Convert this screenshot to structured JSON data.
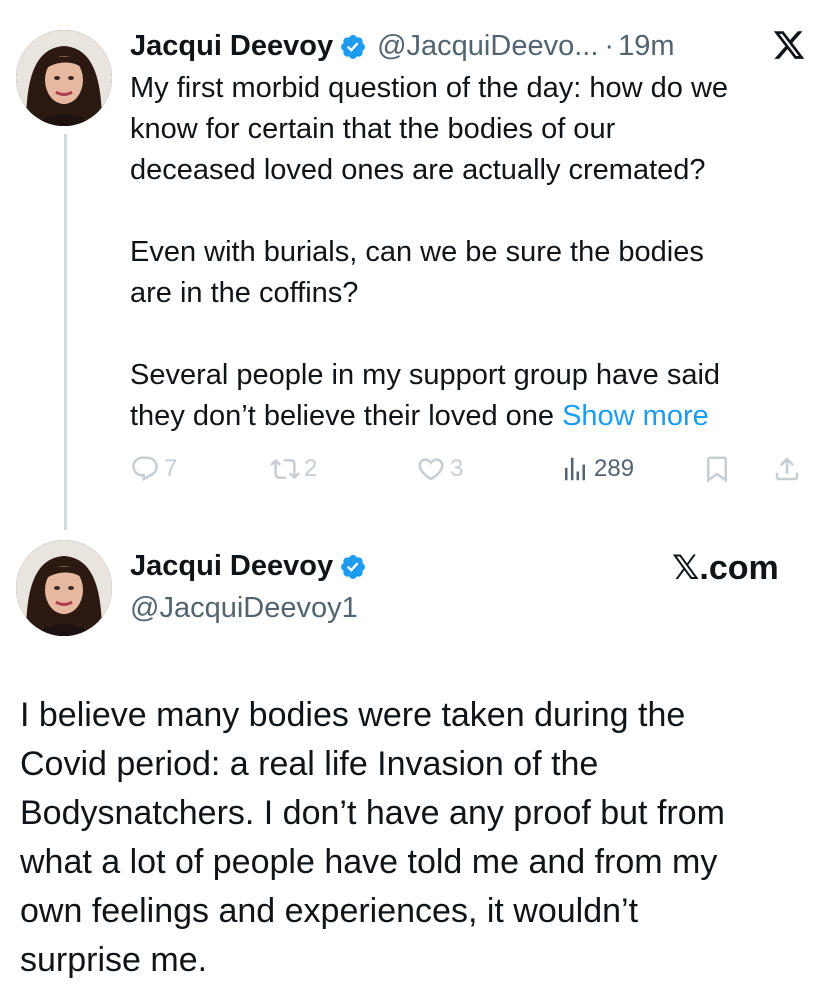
{
  "tweet": {
    "author_name": "Jacqui Deevoy",
    "handle_truncated": "@JacquiDeevo...",
    "separator": "·",
    "time": "19m",
    "text_lines": [
      "My first morbid question of the day: how do we",
      "know for certain that the bodies of our",
      "deceased loved ones are actually cremated?",
      "",
      "Even with burials, can we be sure the bodies",
      "are in the coffins?",
      "",
      "Several people in my support group have said",
      "they don’t believe their loved one "
    ],
    "show_more": "Show more",
    "actions": {
      "replies": "7",
      "reposts": "2",
      "likes": "3",
      "views": "289"
    }
  },
  "card": {
    "author_name": "Jacqui Deevoy",
    "handle": "@JacquiDeevoy1",
    "brand": "𝕏.com",
    "text": "I believe many bodies were taken during the\nCovid period: a real life Invasion of the\nBodysnatchers. I don’t have any proof but from\nwhat a lot of people have told me and from my\nown feelings and experiences, it wouldn’t\nsurprise me."
  },
  "icons": {
    "verified": "verified-badge-icon",
    "x_logo": "x-logo-icon",
    "reply": "reply-icon",
    "repost": "repost-icon",
    "like": "heart-icon",
    "views": "views-icon",
    "bookmark": "bookmark-icon",
    "share": "share-icon"
  },
  "colors": {
    "accent": "#1d9bf0",
    "text": "#0f1419",
    "muted": "#536471",
    "faint": "#c6ced4",
    "line": "#cfd9de"
  }
}
